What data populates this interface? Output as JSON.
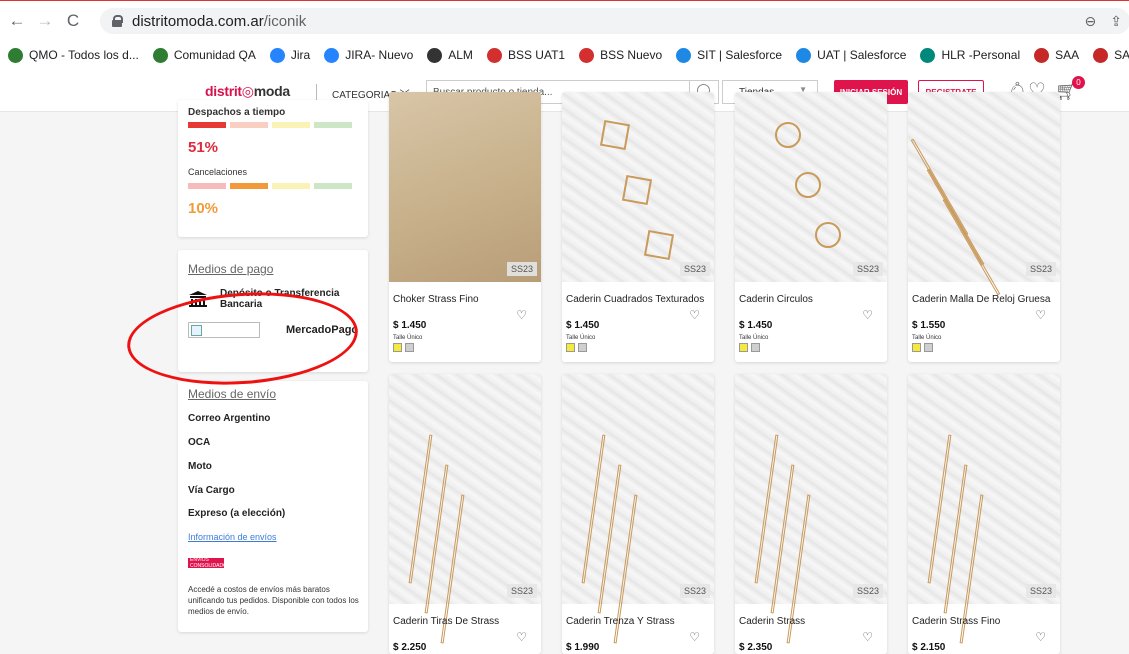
{
  "browser": {
    "url_domain": "distritomoda.com.ar",
    "url_path": "/iconik",
    "bookmarks": [
      {
        "label": "QMO - Todos los d...",
        "color": "#2e7d32"
      },
      {
        "label": "Comunidad QA",
        "color": "#2e7d32"
      },
      {
        "label": "Jira",
        "color": "#2684ff"
      },
      {
        "label": "JIRA- Nuevo",
        "color": "#2684ff"
      },
      {
        "label": "ALM",
        "color": "#333333"
      },
      {
        "label": "BSS UAT1",
        "color": "#d32f2f"
      },
      {
        "label": "BSS Nuevo",
        "color": "#d32f2f"
      },
      {
        "label": "SIT | Salesforce",
        "color": "#1e88e5"
      },
      {
        "label": "UAT | Salesforce",
        "color": "#1e88e5"
      },
      {
        "label": "HLR -Personal",
        "color": "#00897b"
      },
      {
        "label": "SAA",
        "color": "#c62828"
      },
      {
        "label": "SAA IP",
        "color": "#c62828"
      }
    ]
  },
  "header": {
    "logo_part1": "distrit",
    "logo_o": "◎",
    "logo_part2": "moda",
    "categorias": "CATEGORIAS",
    "search_placeholder": "Buscar producto o tienda...",
    "tiendas": "Tiendas",
    "login": "INICIAR SESIÓN",
    "register": "REGISTRATE",
    "cart_count": "0",
    "brand_color": "#e0144d"
  },
  "stats": {
    "despachos_label": "Despachos a tiempo",
    "despachos_pct": "51%",
    "cancel_label": "Cancelaciones",
    "cancel_pct": "10%"
  },
  "payments": {
    "title": "Medios de pago",
    "bank_line1": "Depósito o Transferencia",
    "bank_line2": "Bancaria",
    "mp": "MercadoPago"
  },
  "shipping": {
    "title": "Medios de envío",
    "items": [
      "Correo Argentino",
      "OCA",
      "Moto",
      "Vía Cargo",
      "Expreso (a elección)"
    ],
    "link": "Información de envíos",
    "consol_logo": "ENVÍOS CONSOLIDADOS",
    "note": "Accedé a costos de envíos más baratos unificando tus pedidos. Disponible con todos los medios de envío."
  },
  "products": [
    {
      "name": "Choker Strass Fino",
      "price": "$ 1.450",
      "season": "SS23",
      "size": "Talle Único"
    },
    {
      "name": "Caderin Cuadrados Texturados",
      "price": "$ 1.450",
      "season": "SS23",
      "size": "Talle Único"
    },
    {
      "name": "Caderin Circulos",
      "price": "$ 1.450",
      "season": "SS23",
      "size": "Talle Único"
    },
    {
      "name": "Caderin Malla De Reloj Gruesa",
      "price": "$ 1.550",
      "season": "SS23",
      "size": "Talle Único"
    },
    {
      "name": "Caderin Tiras De Strass",
      "price": "$ 2.250",
      "season": "SS23",
      "size": ""
    },
    {
      "name": "Caderin Trenza Y Strass",
      "price": "$ 1.990",
      "season": "SS23",
      "size": ""
    },
    {
      "name": "Caderin Strass",
      "price": "$ 2.350",
      "season": "SS23",
      "size": ""
    },
    {
      "name": "Caderin Strass Fino",
      "price": "$ 2.150",
      "season": "SS23",
      "size": ""
    }
  ]
}
